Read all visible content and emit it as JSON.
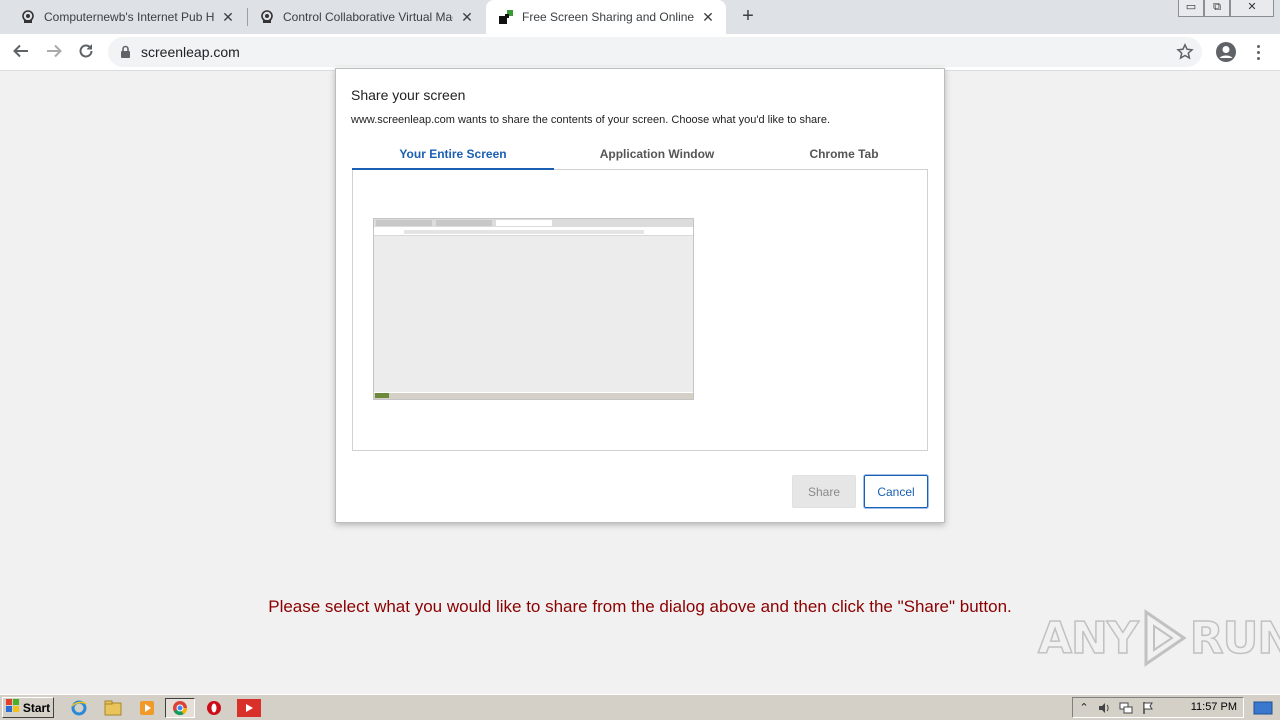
{
  "browser": {
    "tabs": [
      {
        "title": "Computernewb's Internet Pub Hub",
        "favicon": "vm-icon",
        "active": false
      },
      {
        "title": "Control Collaborative Virtual Machine",
        "favicon": "vm-icon",
        "active": false
      },
      {
        "title": "Free Screen Sharing and Online Meetings",
        "favicon": "screenleap-icon",
        "active": true
      }
    ],
    "new_tab": "+",
    "address": "screenleap.com",
    "window_controls": {
      "minimize": "▭",
      "restore": "⧉",
      "close": "✕"
    }
  },
  "dialog": {
    "title": "Share your screen",
    "description": "www.screenleap.com wants to share the contents of your screen. Choose what you'd like to share.",
    "tabs": [
      {
        "label": "Your Entire Screen",
        "active": true
      },
      {
        "label": "Application Window",
        "active": false
      },
      {
        "label": "Chrome Tab",
        "active": false
      }
    ],
    "share_label": "Share",
    "cancel_label": "Cancel"
  },
  "page": {
    "instruction": "Please select what you would like to share from the dialog above and then click the \"Share\" button."
  },
  "watermark": "ANY RUN",
  "taskbar": {
    "start_label": "Start",
    "pinned": [
      "ie-icon",
      "explorer-icon",
      "media-player-icon",
      "chrome-icon",
      "opera-icon",
      "anyrun-icon"
    ],
    "clock": "11:57 PM"
  },
  "colors": {
    "accent": "#1a5fb4",
    "instruction": "#8b0000",
    "tabstrip": "#dee1e6",
    "taskbar": "#d4d0c8"
  }
}
